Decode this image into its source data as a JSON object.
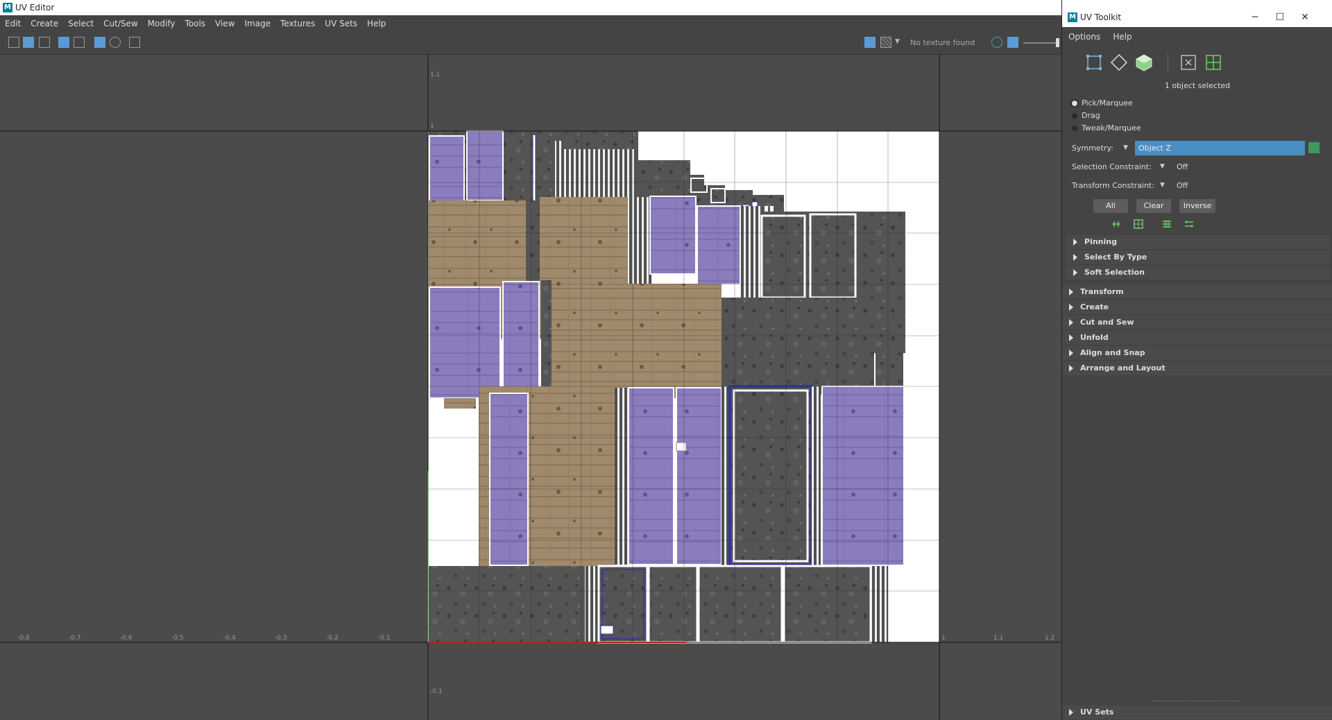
{
  "editor": {
    "title": "UV Editor",
    "menu": [
      "Edit",
      "Create",
      "Select",
      "Cut/Sew",
      "Modify",
      "Tools",
      "View",
      "Image",
      "Textures",
      "UV Sets",
      "Help"
    ],
    "texture_status": "No texture found",
    "axis_labels": {
      "x": [
        "-0.8",
        "-0.7",
        "-0.6",
        "-0.5",
        "-0.4",
        "-0.3",
        "-0.2",
        "-0.1",
        "1",
        "1.1",
        "1.2"
      ],
      "y_top": [
        "1.1",
        "1"
      ],
      "y_bottom": [
        "-0.1"
      ]
    }
  },
  "toolkit": {
    "title": "UV Toolkit",
    "menu": [
      "Options",
      "Help"
    ],
    "selection_status": "1 object selected",
    "modes": [
      "Pick/Marquee",
      "Drag",
      "Tweak/Marquee"
    ],
    "selected_mode": "Pick/Marquee",
    "symmetry_label": "Symmetry:",
    "symmetry_value": "Object Z",
    "selection_constraint_label": "Selection Constraint:",
    "selection_constraint_value": "Off",
    "transform_constraint_label": "Transform Constraint:",
    "transform_constraint_value": "Off",
    "buttons": {
      "all": "All",
      "clear": "Clear",
      "inverse": "Inverse"
    },
    "sub_sections": [
      "Pinning",
      "Select By Type",
      "Soft Selection"
    ],
    "sections": [
      "Transform",
      "Create",
      "Cut and Sew",
      "Unfold",
      "Align and Snap",
      "Arrange and Layout"
    ],
    "footer_section": "UV Sets"
  },
  "colors": {
    "accent": "#3a8fc9",
    "purple_shell": "#8a7ab8",
    "selection_blue": "#3434a0",
    "wood": "#9c8568",
    "concrete": "#505050"
  }
}
